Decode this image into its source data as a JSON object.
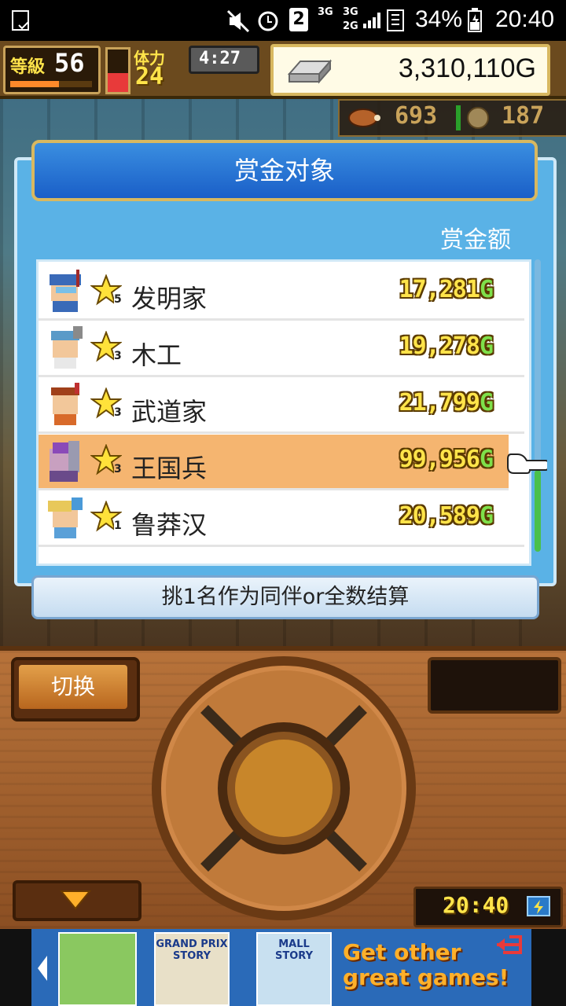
{
  "status_bar": {
    "sim_badge": "2",
    "net1": "3G",
    "net2": "3G",
    "net3": "2G",
    "battery_pct": "34%",
    "time": "20:40"
  },
  "hud": {
    "level_label": "等級",
    "level_value": "56",
    "stamina_label": "体力",
    "stamina_value": "24",
    "timer": "4:27",
    "gold": "3,310,110G",
    "res1_value": "693",
    "res2_value": "187"
  },
  "dialog": {
    "title": "赏金对象",
    "column_header": "赏金额",
    "rows": [
      {
        "name": "发明家",
        "star_level": "5",
        "bounty": "17,281",
        "unit": "G",
        "selected": false
      },
      {
        "name": "木工",
        "star_level": "3",
        "bounty": "19,278",
        "unit": "G",
        "selected": false
      },
      {
        "name": "武道家",
        "star_level": "3",
        "bounty": "21,799",
        "unit": "G",
        "selected": false
      },
      {
        "name": "王国兵",
        "star_level": "3",
        "bounty": "99,956",
        "unit": "G",
        "selected": true
      },
      {
        "name": "鲁莽汉",
        "star_level": "1",
        "bounty": "20,589",
        "unit": "G",
        "selected": false
      }
    ],
    "footer": "挑1名作为同伴or全数结算"
  },
  "controller": {
    "switch_label": "切换",
    "clock": "20:40"
  },
  "ad": {
    "game1": "GRAND PRIX STORY",
    "game2": "MALL STORY",
    "cta": "Get other great games!"
  },
  "colors": {
    "dialog_blue": "#5ab2e6",
    "selected_row": "#f5b570",
    "bounty_yellow": "#ffe44a",
    "gold_g": "#7ee04a"
  }
}
